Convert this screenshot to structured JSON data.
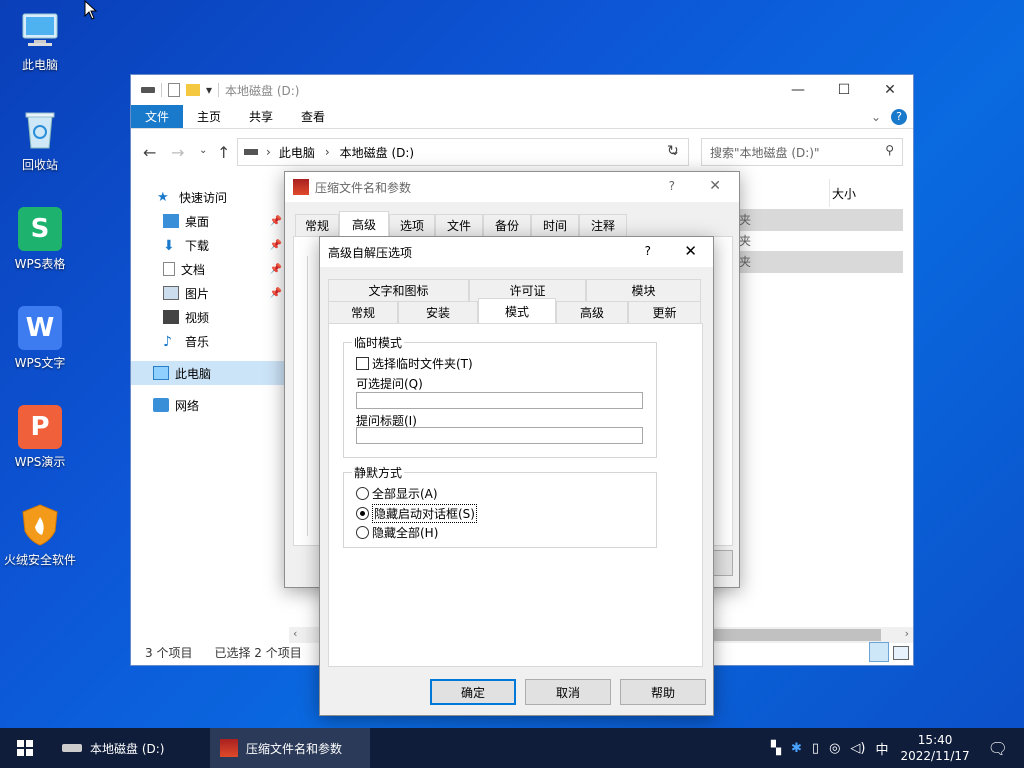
{
  "desktop": {
    "icons": [
      {
        "label": "此电脑"
      },
      {
        "label": "回收站"
      },
      {
        "label": "WPS表格"
      },
      {
        "label": "WPS文字"
      },
      {
        "label": "WPS演示"
      },
      {
        "label": "火绒安全软件"
      }
    ]
  },
  "explorer": {
    "title": "本地磁盘 (D:)",
    "ribbon_tabs": [
      "文件",
      "主页",
      "共享",
      "查看"
    ],
    "address": [
      "此电脑",
      "本地磁盘 (D:)"
    ],
    "search_placeholder": "搜索\"本地磁盘 (D:)\"",
    "column_size": "大小",
    "row_fragments": [
      "夹",
      "夹",
      "夹"
    ],
    "nav": {
      "quick_access": "快速访问",
      "items": [
        "桌面",
        "下载",
        "文档",
        "图片",
        "视频",
        "音乐"
      ],
      "this_pc": "此电脑",
      "network": "网络"
    },
    "status": {
      "count": "3 个项目",
      "selected": "已选择 2 个项目"
    }
  },
  "rar_dialog": {
    "title": "压缩文件名和参数",
    "help": "?",
    "tabs": [
      "常规",
      "高级",
      "选项",
      "文件",
      "备份",
      "时间",
      "注释"
    ]
  },
  "sfx_dialog": {
    "title": "高级自解压选项",
    "help": "?",
    "tabs_row1": [
      "文字和图标",
      "许可证",
      "模块"
    ],
    "tabs_row2": [
      "常规",
      "安装",
      "模式",
      "高级",
      "更新"
    ],
    "temp_group": {
      "title": "临时模式",
      "check_label": "选择临时文件夹(T)",
      "optional_prompt_label": "可选提问(Q)",
      "prompt_title_label": "提问标题(I)"
    },
    "silent_group": {
      "title": "静默方式",
      "options": [
        "全部显示(A)",
        "隐藏启动对话框(S)",
        "隐藏全部(H)"
      ],
      "selected": 1
    },
    "buttons": {
      "ok": "确定",
      "cancel": "取消",
      "help": "帮助"
    }
  },
  "taskbar": {
    "items": [
      "本地磁盘 (D:)",
      "压缩文件名和参数"
    ],
    "ime": "中",
    "time": "15:40",
    "date": "2022/11/17"
  },
  "colors": {
    "accent": "#1979ca",
    "desktop": "#0d56d6",
    "taskbar": "#0f1d3a"
  }
}
